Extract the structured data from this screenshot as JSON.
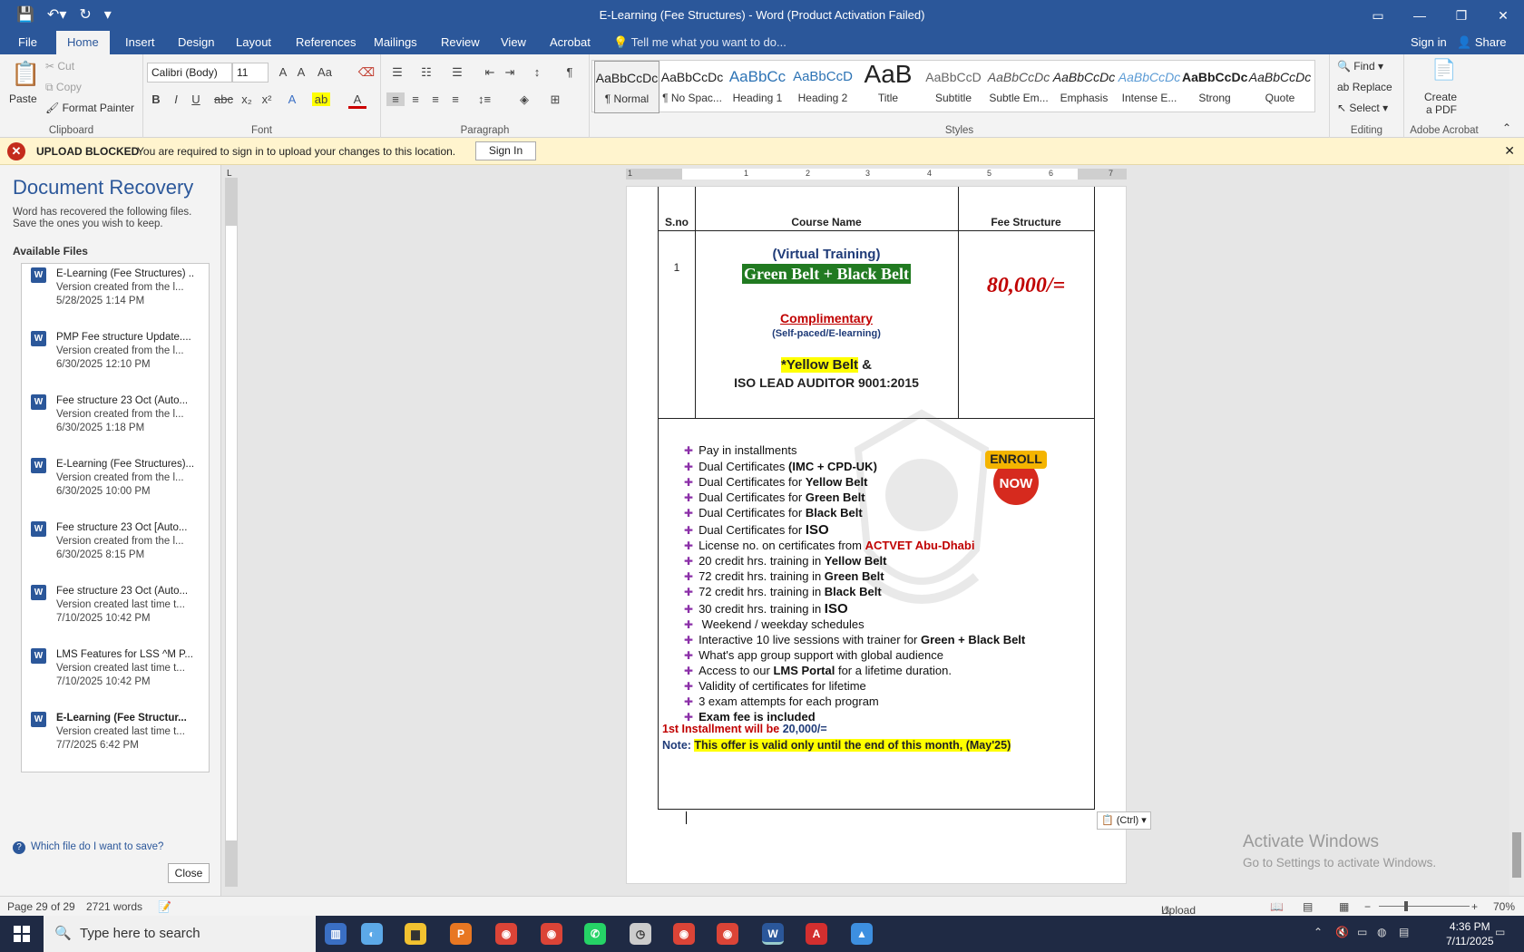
{
  "titlebar": {
    "title": "E-Learning (Fee Structures) - Word (Product Activation Failed)"
  },
  "tabs": [
    "File",
    "Home",
    "Insert",
    "Design",
    "Layout",
    "References",
    "Mailings",
    "Review",
    "View",
    "Acrobat"
  ],
  "tell_me": "Tell me what you want to do...",
  "sign_in": "Sign in",
  "share": "Share",
  "ribbon": {
    "clipboard": {
      "paste": "Paste",
      "cut": "Cut",
      "copy": "Copy",
      "format_painter": "Format Painter",
      "label": "Clipboard"
    },
    "font": {
      "name": "Calibri (Body)",
      "size": "11",
      "label": "Font"
    },
    "paragraph": {
      "label": "Paragraph"
    },
    "styles": {
      "label": "Styles",
      "items": [
        {
          "preview": "AaBbCcDc",
          "name": "¶ Normal"
        },
        {
          "preview": "AaBbCcDc",
          "name": "¶ No Spac..."
        },
        {
          "preview": "AaBbCc",
          "name": "Heading 1"
        },
        {
          "preview": "AaBbCcD",
          "name": "Heading 2"
        },
        {
          "preview": "AaB",
          "name": "Title"
        },
        {
          "preview": "AaBbCcD",
          "name": "Subtitle"
        },
        {
          "preview": "AaBbCcDc",
          "name": "Subtle Em..."
        },
        {
          "preview": "AaBbCcDc",
          "name": "Emphasis"
        },
        {
          "preview": "AaBbCcDc",
          "name": "Intense E..."
        },
        {
          "preview": "AaBbCcDc",
          "name": "Strong"
        },
        {
          "preview": "AaBbCcDc",
          "name": "Quote"
        }
      ]
    },
    "editing": {
      "find": "Find",
      "replace": "Replace",
      "select": "Select",
      "label": "Editing"
    },
    "acrobat": {
      "create": "Create",
      "pdf": "a PDF",
      "label": "Adobe Acrobat"
    }
  },
  "message_bar": {
    "heading": "UPLOAD BLOCKED",
    "text": "You are required to sign in to upload your changes to this location.",
    "button": "Sign In"
  },
  "recovery": {
    "title": "Document Recovery",
    "intro": "Word has recovered the following files. Save the ones you wish to keep.",
    "available": "Available Files",
    "files": [
      {
        "name": "E-Learning (Fee Structures) ..",
        "desc": "Version created from the l...",
        "date": "5/28/2025 1:14 PM"
      },
      {
        "name": "PMP Fee structure Update....",
        "desc": "Version created from the l...",
        "date": "6/30/2025 12:10 PM"
      },
      {
        "name": "Fee structure 23 Oct (Auto...",
        "desc": "Version created from the l...",
        "date": "6/30/2025 1:18 PM"
      },
      {
        "name": "E-Learning (Fee Structures)...",
        "desc": "Version created from the l...",
        "date": "6/30/2025 10:00 PM"
      },
      {
        "name": "Fee structure 23 Oct  [Auto...",
        "desc": "Version created from the l...",
        "date": "6/30/2025 8:15 PM"
      },
      {
        "name": "Fee structure 23 Oct (Auto...",
        "desc": "Version created last time t...",
        "date": "7/10/2025 10:42 PM"
      },
      {
        "name": "LMS Features for LSS ^M P...",
        "desc": "Version created last time t...",
        "date": "7/10/2025 10:42 PM"
      },
      {
        "name": "E-Learning (Fee Structur...",
        "desc": "Version created last time t...",
        "date": "7/7/2025 6:42 PM"
      }
    ],
    "which": "Which file do I want to save?",
    "close": "Close"
  },
  "ruler_numbers": [
    "1",
    "1",
    "2",
    "3",
    "4",
    "5",
    "6",
    "7"
  ],
  "document": {
    "headers": {
      "sno": "S.no",
      "course": "Course Name",
      "fee": "Fee Structure"
    },
    "row_no": "1",
    "virtual": "(Virtual Training)",
    "belts": "Green Belt + Black Belt",
    "complimentary": "Complimentary",
    "self_paced": "(Self-paced/E-learning)",
    "yellow_belt": "*Yellow Belt",
    "amp": " &",
    "iso_lead": "ISO LEAD AUDITOR 9001:2015",
    "fee": "80,000/=",
    "enroll": "ENROLL",
    "now": "NOW",
    "features": [
      [
        "Pay in installments",
        "",
        ""
      ],
      [
        "Dual Certificates ",
        "(IMC + CPD-UK)",
        ""
      ],
      [
        "Dual Certificates for ",
        "Yellow Belt",
        ""
      ],
      [
        "Dual Certificates for ",
        "Green Belt",
        ""
      ],
      [
        "Dual Certificates for ",
        "Black Belt",
        ""
      ],
      [
        "Dual Certificates for  ",
        "ISO",
        ""
      ],
      [
        "License no. on certificates from ",
        "ACTVET Abu-Dhabi",
        ""
      ],
      [
        "20 credit hrs. training in ",
        "Yellow Belt",
        ""
      ],
      [
        "72 credit hrs. training in ",
        "Green Belt",
        ""
      ],
      [
        "72 credit hrs. training in ",
        "Black Belt",
        ""
      ],
      [
        "30 credit hrs. training in  ",
        "ISO",
        ""
      ],
      [
        " Weekend / weekday schedules",
        "",
        ""
      ],
      [
        "Interactive 10 live sessions with trainer for ",
        "Green + Black Belt",
        ""
      ],
      [
        "What's app group support with global audience",
        "",
        ""
      ],
      [
        "Access to our ",
        "LMS Portal",
        " for a lifetime duration."
      ],
      [
        "Validity of certificates for lifetime",
        "",
        ""
      ],
      [
        "3 exam attempts for each program",
        "",
        ""
      ],
      [
        "",
        "Exam fee is included",
        ""
      ]
    ],
    "installment_label": "1st Installment will be ",
    "installment_value": "20,000/=",
    "note_label": "Note: ",
    "note_text": "This offer is valid only until the end of this month, (May'25)"
  },
  "ctrl": "(Ctrl)",
  "activate": {
    "line1": "Activate Windows",
    "line2": "Go to Settings to activate Windows."
  },
  "status": {
    "page": "Page 29 of 29",
    "words": "2721 words",
    "upload": "Upload Failed",
    "zoom": "70%"
  },
  "taskbar": {
    "search": "Type here to search",
    "time": "4:36 PM",
    "date": "7/11/2025"
  }
}
